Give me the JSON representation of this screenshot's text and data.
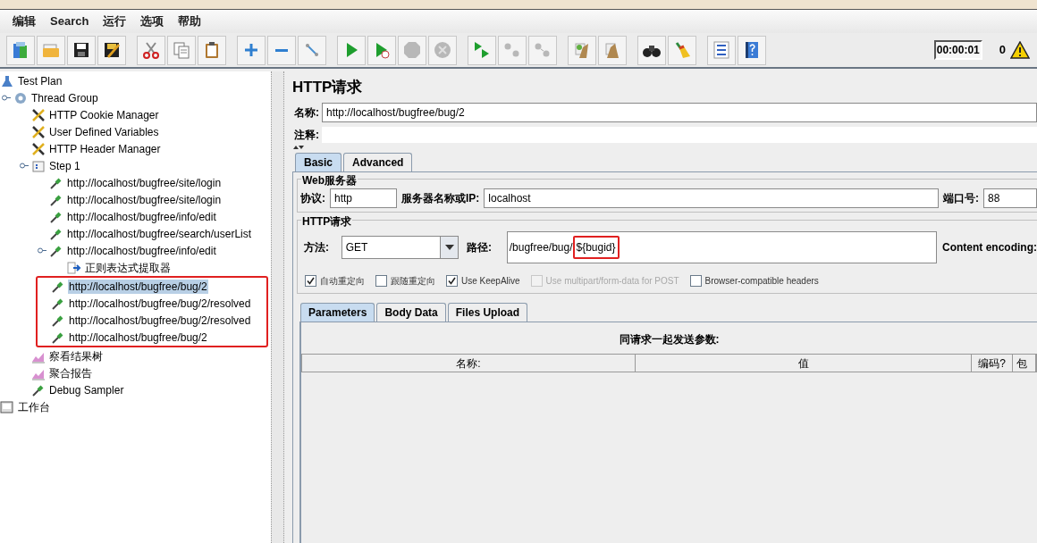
{
  "menu": [
    "编辑",
    "Search",
    "运行",
    "选项",
    "帮助"
  ],
  "toolbar": [
    [
      {
        "kind": "templates",
        "disabled": false
      },
      {
        "kind": "open",
        "disabled": false
      },
      {
        "kind": "save",
        "disabled": false
      },
      {
        "kind": "save_as",
        "disabled": false
      }
    ],
    [
      {
        "kind": "cut",
        "disabled": false
      },
      {
        "kind": "copy",
        "disabled": false
      },
      {
        "kind": "paste",
        "disabled": false
      }
    ],
    [
      {
        "kind": "expand",
        "disabled": false
      },
      {
        "kind": "collapse",
        "disabled": false
      },
      {
        "kind": "toggle",
        "disabled": false
      }
    ],
    [
      {
        "kind": "start",
        "disabled": false
      },
      {
        "kind": "start_no_timers",
        "disabled": false
      },
      {
        "kind": "stop",
        "disabled": true
      },
      {
        "kind": "shutdown",
        "disabled": true
      }
    ],
    [
      {
        "kind": "remote_start",
        "disabled": false
      },
      {
        "kind": "remote_stop",
        "disabled": true
      },
      {
        "kind": "remote_shutdown",
        "disabled": true
      }
    ],
    [
      {
        "kind": "clear",
        "disabled": false
      },
      {
        "kind": "clear_all",
        "disabled": false
      }
    ],
    [
      {
        "kind": "search",
        "disabled": false
      },
      {
        "kind": "reset",
        "disabled": false
      }
    ],
    [
      {
        "kind": "functions",
        "disabled": false
      },
      {
        "kind": "help",
        "disabled": false
      }
    ]
  ],
  "timer": "00:00:01",
  "error_count": "0",
  "tree": [
    {
      "label": "Test Plan",
      "kind": "plan",
      "selected": false,
      "highlighted": false,
      "expanded": true,
      "children": [
        {
          "label": "Thread Group",
          "kind": "thread",
          "selected": false,
          "highlighted": false,
          "expanded": true,
          "children": [
            {
              "label": "HTTP Cookie Manager",
              "kind": "config",
              "selected": false,
              "highlighted": false
            },
            {
              "label": "User Defined Variables",
              "kind": "config",
              "selected": false,
              "highlighted": false
            },
            {
              "label": "HTTP Header Manager",
              "kind": "config",
              "selected": false,
              "highlighted": false
            },
            {
              "label": "Step 1",
              "kind": "controller",
              "selected": false,
              "highlighted": false,
              "expanded": true,
              "children": [
                {
                  "label": "http://localhost/bugfree/site/login",
                  "kind": "sampler",
                  "selected": false,
                  "highlighted": false
                },
                {
                  "label": "http://localhost/bugfree/site/login",
                  "kind": "sampler",
                  "selected": false,
                  "highlighted": false
                },
                {
                  "label": "http://localhost/bugfree/info/edit",
                  "kind": "sampler",
                  "selected": false,
                  "highlighted": false
                },
                {
                  "label": "http://localhost/bugfree/search/userList",
                  "kind": "sampler",
                  "selected": false,
                  "highlighted": false
                },
                {
                  "label": "http://localhost/bugfree/info/edit",
                  "kind": "sampler",
                  "selected": false,
                  "highlighted": false,
                  "expanded": true,
                  "children": [
                    {
                      "label": "正则表达式提取器",
                      "kind": "extractor",
                      "selected": false,
                      "highlighted": false
                    }
                  ]
                },
                {
                  "label": "http://localhost/bugfree/bug/2",
                  "kind": "sampler",
                  "selected": true,
                  "highlighted": true
                },
                {
                  "label": "http://localhost/bugfree/bug/2/resolved",
                  "kind": "sampler",
                  "selected": false,
                  "highlighted": true
                },
                {
                  "label": "http://localhost/bugfree/bug/2/resolved",
                  "kind": "sampler",
                  "selected": false,
                  "highlighted": true
                },
                {
                  "label": "http://localhost/bugfree/bug/2",
                  "kind": "sampler",
                  "selected": false,
                  "highlighted": true
                }
              ]
            },
            {
              "label": "察看结果树",
              "kind": "listener",
              "selected": false,
              "highlighted": false
            },
            {
              "label": "聚合报告",
              "kind": "listener",
              "selected": false,
              "highlighted": false
            },
            {
              "label": "Debug Sampler",
              "kind": "sampler",
              "selected": false,
              "highlighted": false
            }
          ]
        }
      ]
    },
    {
      "label": "工作台",
      "kind": "workbench",
      "selected": false,
      "highlighted": false
    }
  ],
  "panel": {
    "title": "HTTP请求",
    "name": {
      "label": "名称:",
      "value": "http://localhost/bugfree/bug/2"
    },
    "comment": {
      "label": "注释:"
    },
    "tabs": [
      {
        "label": "Basic",
        "selected": true
      },
      {
        "label": "Advanced",
        "selected": false
      }
    ],
    "web_server": {
      "title": "Web服务器",
      "protocol": {
        "label": "协议:",
        "value": "http"
      },
      "server": {
        "label": "服务器名称或IP:",
        "value": "localhost"
      },
      "port": {
        "label": "端口号:",
        "value": "88"
      }
    },
    "http_request": {
      "title": "HTTP请求",
      "method": {
        "label": "方法:",
        "value": "GET"
      },
      "path": {
        "label": "路径:",
        "value": "/bugfree/bug/",
        "highlighted_value": "${bugid}"
      },
      "encoding": {
        "label": "Content encoding:"
      },
      "options": [
        {
          "label": "自动重定向",
          "checked": true,
          "disabled": false
        },
        {
          "label": "跟随重定向",
          "checked": false,
          "disabled": false
        },
        {
          "label": "Use KeepAlive",
          "checked": true,
          "disabled": false
        },
        {
          "label": "Use multipart/form-data for POST",
          "checked": false,
          "disabled": true
        },
        {
          "label": "Browser-compatible headers",
          "checked": false,
          "disabled": false
        }
      ]
    },
    "sub_tabs": [
      {
        "label": "Parameters",
        "selected": true
      },
      {
        "label": "Body Data",
        "selected": false
      },
      {
        "label": "Files Upload",
        "selected": false
      }
    ],
    "params": {
      "caption": "同请求一起发送参数:",
      "columns": [
        "名称:",
        "值",
        "编码?",
        "包"
      ]
    }
  }
}
